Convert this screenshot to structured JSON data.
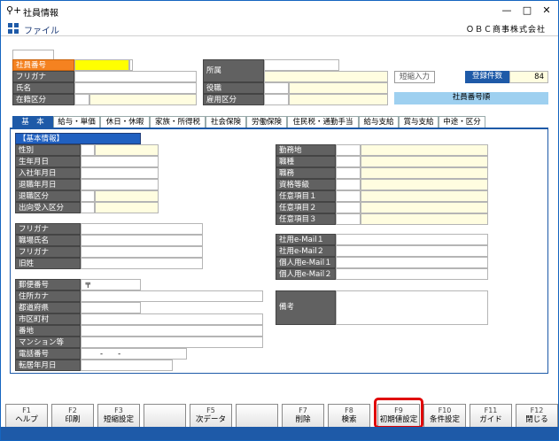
{
  "window": {
    "title": "社員情報"
  },
  "menu": {
    "file": "ファイル",
    "company": "ＯＢＣ商事株式会社"
  },
  "header": {
    "emp_no": "社員番号",
    "furigana": "フリガナ",
    "name": "氏名",
    "status": "在籍区分",
    "dept": "所属",
    "position": "役職",
    "employment": "雇用区分",
    "shortcut_button": "短縮入力",
    "count_label": "登録件数",
    "count_value": "84",
    "order_label": "社員番号順"
  },
  "tabs": [
    "基　本",
    "給与・単価",
    "休日・休暇",
    "家族・所得税",
    "社会保険",
    "労働保険",
    "住民税・通勤手当",
    "給与支給",
    "賞与支給",
    "中途・区分"
  ],
  "basic": {
    "section": "【基本情報】",
    "left": [
      "性別",
      "生年月日",
      "入社年月日",
      "退職年月日",
      "退職区分",
      "出向受入区分"
    ],
    "right": [
      "勤務地",
      "職種",
      "職務",
      "資格等級",
      "任意項目１",
      "任意項目２",
      "任意項目３"
    ],
    "name2": [
      "フリガナ",
      "職場氏名",
      "フリガナ",
      "旧姓"
    ],
    "mail": [
      "社用e-Mail１",
      "社用e-Mail２",
      "個人用e-Mail１",
      "個人用e-Mail２"
    ],
    "address": [
      "郵便番号",
      "住所カナ",
      "都道府県",
      "市区町村",
      "番地",
      "マンション等",
      "電話番号",
      "転居年月日"
    ],
    "postal_mark": "〒",
    "phone_value": "-　　-",
    "remarks": "備考"
  },
  "fkeys": [
    {
      "key": "F1",
      "label": "ヘルプ"
    },
    {
      "key": "F2",
      "label": "印刷"
    },
    {
      "key": "F3",
      "label": "短縮設定"
    },
    {
      "key": "",
      "label": ""
    },
    {
      "key": "F5",
      "label": "次データ"
    },
    {
      "key": "",
      "label": ""
    },
    {
      "key": "F7",
      "label": "削除"
    },
    {
      "key": "F8",
      "label": "検索"
    },
    {
      "key": "F9",
      "label": "初期値設定"
    },
    {
      "key": "F10",
      "label": "条件設定"
    },
    {
      "key": "F11",
      "label": "ガイド"
    },
    {
      "key": "F12",
      "label": "閉じる"
    }
  ],
  "colors": {
    "accent": "#1e5aa8",
    "label_bg": "#616161",
    "highlight": "#e00000",
    "selected_field": "#ffff00"
  }
}
